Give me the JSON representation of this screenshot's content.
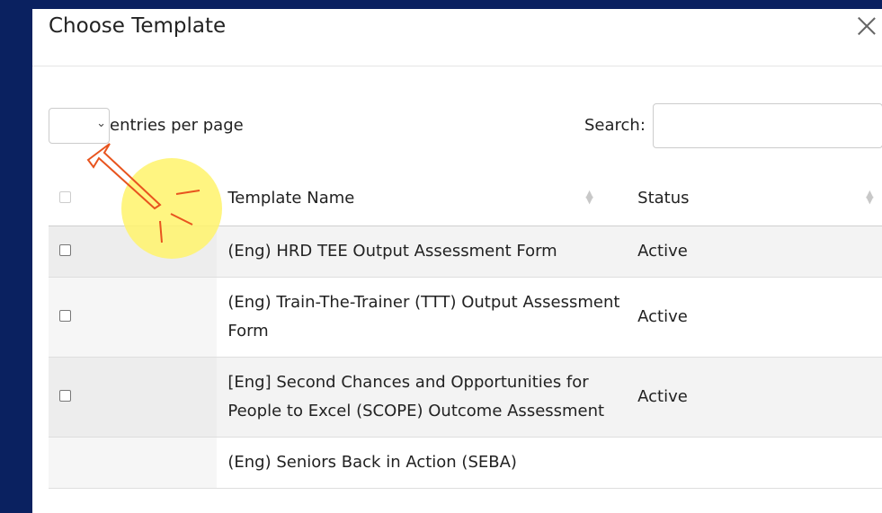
{
  "modal": {
    "title": "Choose Template"
  },
  "controls": {
    "entries_value": "",
    "entries_label": "entries per page",
    "search_label": "Search:",
    "search_value": ""
  },
  "table": {
    "headers": {
      "name": "Template Name",
      "status": "Status"
    },
    "rows": [
      {
        "name": "(Eng) HRD TEE Output Assessment Form",
        "status": "Active"
      },
      {
        "name": "(Eng) Train-The-Trainer (TTT) Output Assessment Form",
        "status": "Active"
      },
      {
        "name": "[Eng] Second Chances and Opportunities for People to Excel (SCOPE) Outcome Assessment",
        "status": "Active"
      },
      {
        "name": "(Eng) Seniors Back in Action (SEBA)",
        "status": ""
      }
    ]
  },
  "colors": {
    "backdrop": "#0a2160",
    "highlight": "#fff36b",
    "arrow": "#e8541e"
  }
}
